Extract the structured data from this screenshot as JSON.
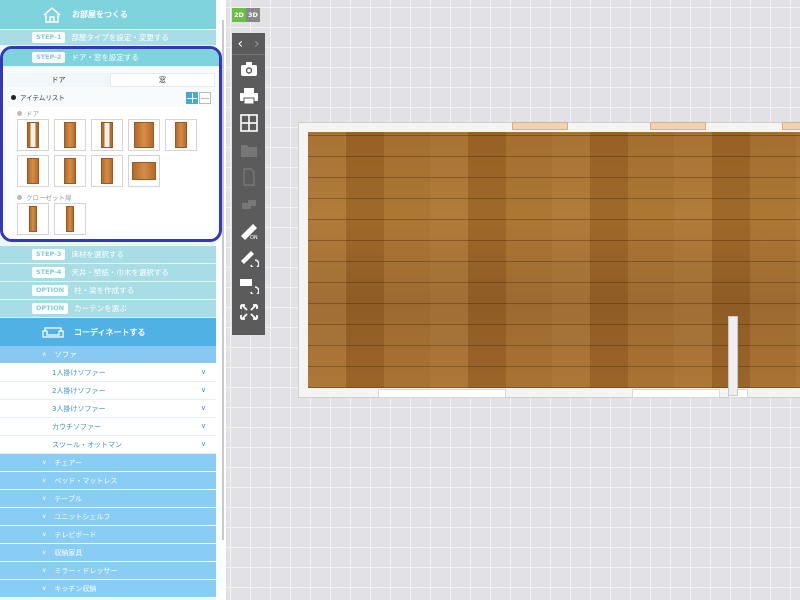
{
  "sidebar": {
    "room_header": "お部屋をつくる",
    "step1": {
      "tag": "STEP-1",
      "label": "部屋タイプを設定・変更する"
    },
    "step2": {
      "tag": "STEP-2",
      "label": "ドア・窓を設定する"
    },
    "tabs": [
      {
        "label": "ドア"
      },
      {
        "label": "窓"
      }
    ],
    "item_list_label": "アイテムリスト",
    "category_door": "ドア",
    "category_closet": "クローゼット扉",
    "door_count": 9,
    "closet_count": 2,
    "step3": {
      "tag": "STEP-3",
      "label": "床材を選択する"
    },
    "step4": {
      "tag": "STEP-4",
      "label": "天井・壁紙・巾木を選択する"
    },
    "option1": {
      "tag": "OPTION",
      "label": "柱・梁を作成する"
    },
    "option2": {
      "tag": "OPTION",
      "label": "カーテンを選ぶ"
    },
    "coord_header": "コーディネートする",
    "sofa": "ソファ",
    "sofa_items": [
      "1人掛けソファー",
      "2人掛けソファー",
      "3人掛けソファー",
      "カウチソファー",
      "スツール・オットマン"
    ],
    "categories": [
      "チェアー",
      "ベッド・マットレス",
      "テーブル",
      "ユニットシェルフ",
      "テレビボード",
      "収納家具",
      "ミラー・ドレッサー",
      "キッチン収納"
    ]
  },
  "canvas": {
    "mode_2d": "2D",
    "mode_3d": "3D",
    "active_mode": "2D",
    "tools": [
      "camera-icon",
      "print-icon",
      "grid-icon",
      "folder-icon",
      "document-icon",
      "copy-icon",
      "ruler-on-icon",
      "ruler-rotate-icon",
      "rotate-view-icon",
      "fit-screen-icon"
    ]
  },
  "colors": {
    "accent_teal": "#7ed3dd",
    "accent_blue": "#4fb1e4",
    "highlight_border": "#3338b6",
    "floor": "#9b6626"
  }
}
